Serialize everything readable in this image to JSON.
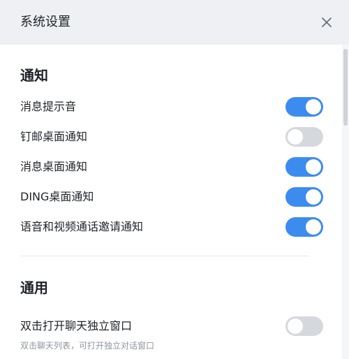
{
  "dialog": {
    "title": "系统设置",
    "close_icon": "close-icon"
  },
  "notify": {
    "title": "通知",
    "items": [
      {
        "label": "消息提示音",
        "enabled": true
      },
      {
        "label": "钉邮桌面通知",
        "enabled": false
      },
      {
        "label": "消息桌面通知",
        "enabled": true
      },
      {
        "label": "DING桌面通知",
        "enabled": true
      },
      {
        "label": "语音和视频通话邀请通知",
        "enabled": true
      }
    ]
  },
  "general": {
    "title": "通用",
    "items": [
      {
        "label": "双击打开聊天独立窗口",
        "description": "双击聊天列表，可打开独立对话窗口",
        "enabled": false
      }
    ]
  },
  "colors": {
    "toggle_on": "#3c8cf0",
    "toggle_off": "#d5d8dc",
    "header_bg": "#eef0f3"
  }
}
